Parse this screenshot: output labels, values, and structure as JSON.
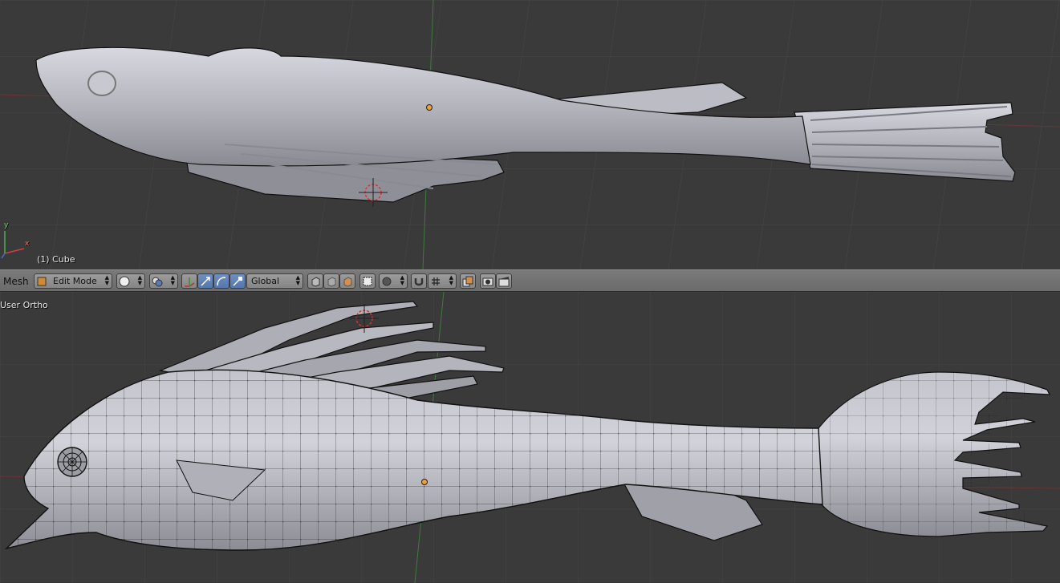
{
  "viewport_top": {
    "object_label": "(1) Cube",
    "axes_widget": {
      "x": "x",
      "y": "y"
    }
  },
  "viewport_bottom": {
    "view_label": "User Ortho"
  },
  "header": {
    "menu_label": "Mesh",
    "mode_select": {
      "value": "Edit Mode"
    },
    "transform_orientation": {
      "value": "Global"
    },
    "icons": [
      "mode-icon",
      "pivot-point-icon",
      "manipulator-icon",
      "translate-icon",
      "rotate-icon",
      "scale-icon",
      "vertex-select-icon",
      "edge-select-icon",
      "face-select-icon",
      "occlude-geometry-icon",
      "proportional-edit-icon",
      "snap-magnet-icon",
      "snap-target-icon",
      "copy-icon",
      "render-icon",
      "render-animation-icon"
    ]
  },
  "colors": {
    "background": "#3a3a3a",
    "header": "#727272",
    "grid": "#454545",
    "mesh": "#b9b9c2",
    "x_axis": "#7a2f2f",
    "y_axis": "#3e8a3e",
    "cursor": "#e03030",
    "origin": "#f0a030"
  }
}
